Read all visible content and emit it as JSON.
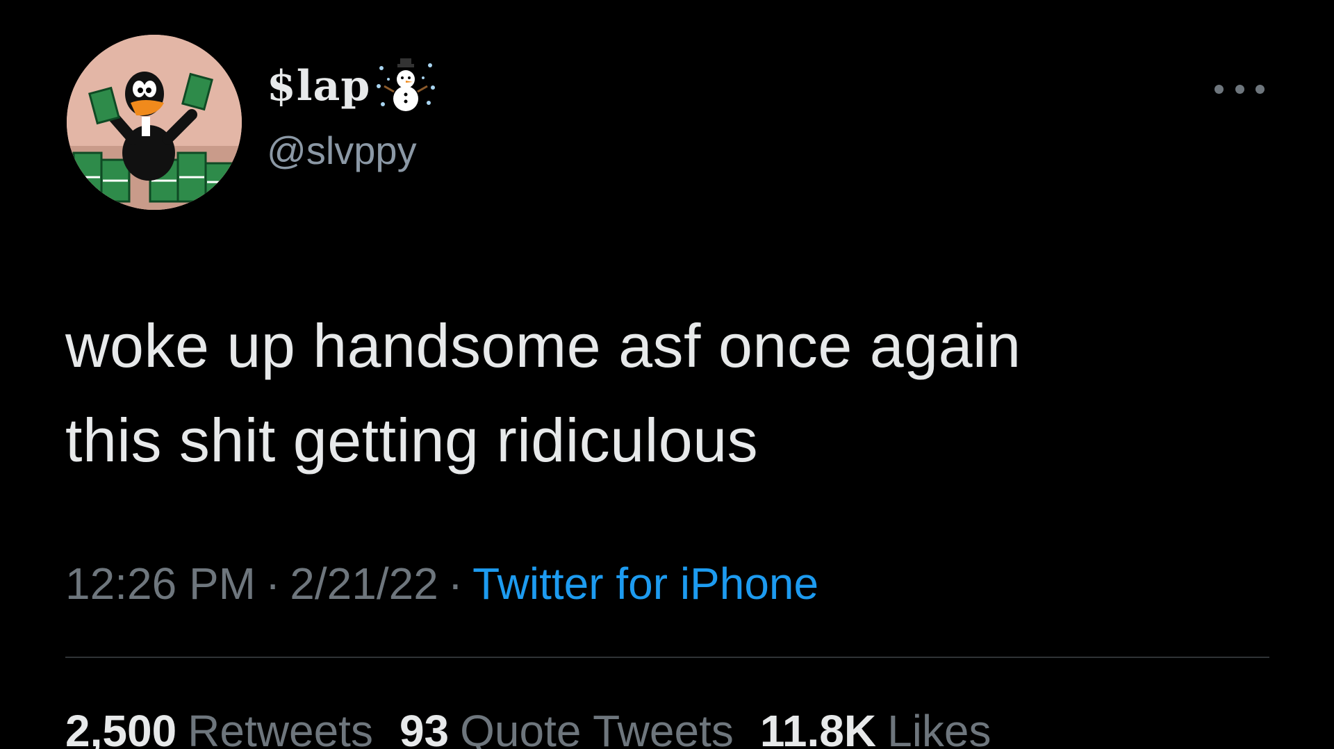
{
  "author": {
    "display_name": "$lap",
    "display_emoji": "snowman-icon",
    "handle": "@slvppy",
    "avatar_icon": "duck-with-money-icon"
  },
  "tweet": {
    "line1": "woke up handsome asf once again",
    "line2": "this shit getting ridiculous"
  },
  "meta": {
    "time": "12:26 PM",
    "separator": "·",
    "date": "2/21/22",
    "source": "Twitter for iPhone"
  },
  "stats": [
    {
      "count": "2,500",
      "label": "Retweets"
    },
    {
      "count": "93",
      "label": "Quote Tweets"
    },
    {
      "count": "11.8K",
      "label": "Likes"
    }
  ],
  "colors": {
    "background": "#000000",
    "text": "#e7e9ea",
    "muted": "#6e767d",
    "link": "#1d9bf0",
    "divider": "#2f3336"
  }
}
